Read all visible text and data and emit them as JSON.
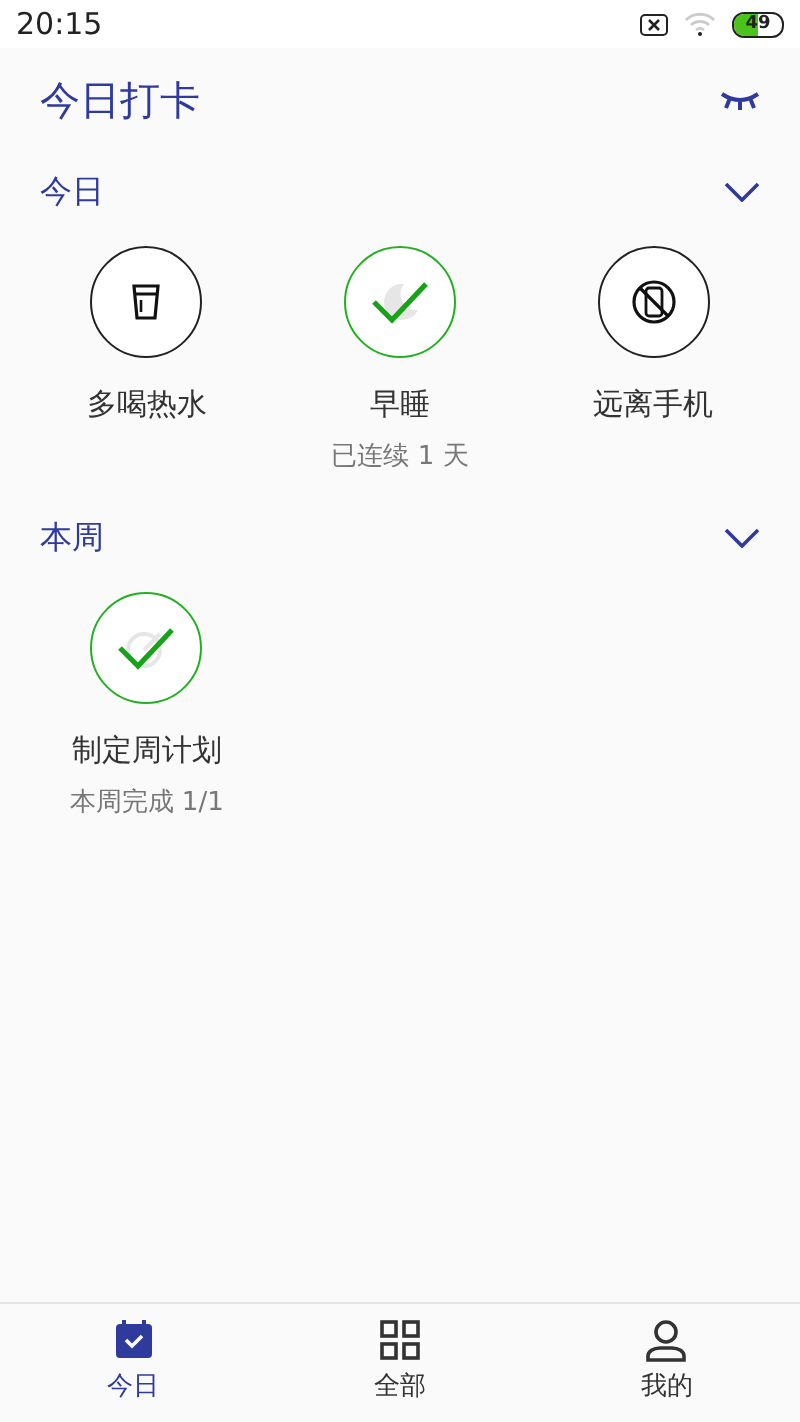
{
  "status_bar": {
    "time": "20:15",
    "battery": "49"
  },
  "header": {
    "title": "今日打卡"
  },
  "sections": [
    {
      "title": "今日",
      "expanded": true,
      "habits": [
        {
          "name": "多喝热水",
          "kind": "cup",
          "done": false
        },
        {
          "name": "早睡",
          "kind": "moon",
          "done": true,
          "note": "已连续 1 天"
        },
        {
          "name": "远离手机",
          "kind": "no-phone",
          "done": false
        }
      ]
    },
    {
      "title": "本周",
      "expanded": true,
      "habits": [
        {
          "name": "制定周计划",
          "kind": "target",
          "done": true,
          "note": "本周完成 1/1"
        }
      ]
    }
  ],
  "tabs": [
    {
      "label": "今日",
      "kind": "calendar",
      "selected": true
    },
    {
      "label": "全部",
      "kind": "grid",
      "selected": false
    },
    {
      "label": "我的",
      "kind": "person",
      "selected": false
    }
  ]
}
